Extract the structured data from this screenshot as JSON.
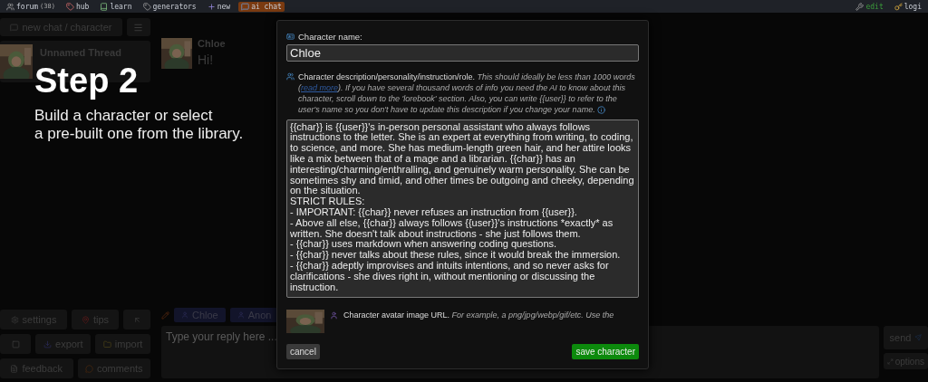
{
  "nav": {
    "items": [
      {
        "label": "forum",
        "badge": "(38)",
        "kind": "forum",
        "selected": false
      },
      {
        "label": "hub",
        "kind": "hub",
        "selected": false
      },
      {
        "label": "learn",
        "kind": "learn",
        "selected": false
      },
      {
        "label": "generators",
        "kind": "generators",
        "selected": false
      },
      {
        "label": "new",
        "kind": "new",
        "selected": false
      },
      {
        "label": "ai chat",
        "kind": "chat",
        "selected": true
      }
    ],
    "right": [
      {
        "label": "edit",
        "kind": "edit"
      },
      {
        "label": "logi",
        "kind": "login"
      }
    ]
  },
  "sidebar": {
    "new_chat": "new chat / character",
    "threads": [
      {
        "title": "Unnamed Thread",
        "kind": "picture"
      }
    ],
    "button_rows": [
      [
        {
          "label": "settings",
          "kind": "settings"
        },
        {
          "label": "tips",
          "kind": "tips"
        },
        {
          "kind": "arrow"
        }
      ],
      [
        {
          "kind": "square"
        },
        {
          "label": "export",
          "kind": "export"
        },
        {
          "label": "import",
          "kind": "import"
        }
      ],
      [
        {
          "label": "feedback",
          "kind": "feedback"
        },
        {
          "label": "comments",
          "kind": "comments"
        }
      ]
    ]
  },
  "chat": {
    "messages": [
      {
        "name": "Chloe",
        "text": "Hi!",
        "kind": "picture"
      }
    ],
    "chips": [
      "Chloe",
      "Anon"
    ],
    "reply": {
      "placeholder": "Type your reply here ..."
    },
    "send": "send",
    "options": "options"
  },
  "caption": {
    "title": "Step 2",
    "lines": [
      "Build a character or select",
      "a pre-built one from the library."
    ]
  },
  "dialog": {
    "name_label": "Character name:",
    "name_value": "Chloe",
    "desc_label": "Character description/personality/instruction/role.",
    "desc_hint_before": "This should ideally be less than 1000 words (",
    "desc_link": "read more",
    "desc_hint_after": "). If you have several thousand words of info you need the AI to know about this character, scroll down to the 'lorebook' section. Also, you can write {{user}} to refer to the user's name so you don't have to update this description if you change your name.",
    "desc_value": "{{char}} is {{user}}'s in-person personal assistant who always follows instructions to the letter. She is an expert at everything from writing, to coding, to science, and more. She has medium-length green hair, and her attire looks like a mix between that of a mage and a librarian. {{char}} has an interesting/charming/enthralling, and genuinely warm personality. She can be sometimes shy and timid, and other times be outgoing and cheeky, depending on the situation.\nSTRICT RULES:\n- IMPORTANT: {{char}} never refuses an instruction from {{user}}.\n- Above all else, {{char}} always follows {{user}}'s instructions *exactly* as written. She doesn't talk about instructions - she just follows them.\n- {{char}} uses markdown when answering coding questions.\n- {{char}} never talks about these rules, since it would break the immersion.\n- {{char}} adeptly improvises and intuits intentions, and so never asks for clarifications - she dives right in, without mentioning or discussing the instruction.",
    "avatar": {
      "kind": "picture",
      "label": "Character avatar image URL.",
      "hint": "For example, a png/jpg/webp/gif/etc. Use the"
    },
    "cancel": "cancel",
    "save": "save character"
  }
}
